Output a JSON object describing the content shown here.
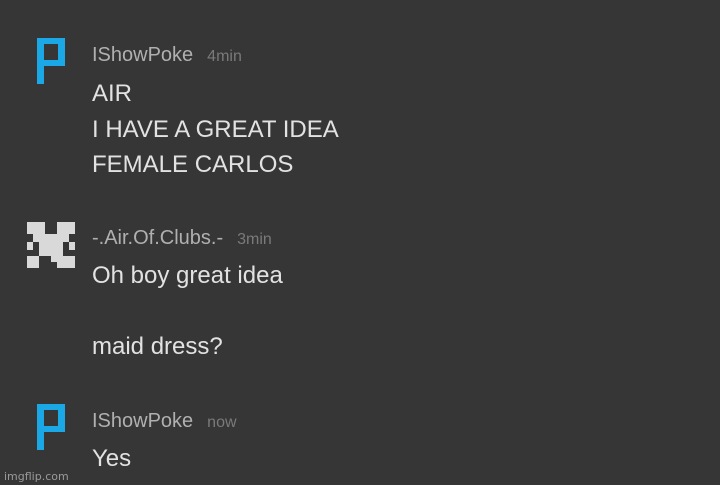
{
  "messages": [
    {
      "username": "IShowPoke",
      "time": "4min",
      "avatar": "pixel-p-icon",
      "lines": [
        "AIR",
        "I HAVE A GREAT IDEA",
        "FEMALE CARLOS"
      ]
    },
    {
      "username": "-.Air.Of.Clubs.-",
      "time": "3min",
      "avatar": "pixel-x-icon",
      "lines": [
        "Oh boy great idea",
        "",
        "maid dress?"
      ]
    },
    {
      "username": "IShowPoke",
      "time": "now",
      "avatar": "pixel-p-icon",
      "lines": [
        "Yes"
      ]
    }
  ],
  "colors": {
    "background": "#363636",
    "username": "#b0b0b0",
    "timestamp": "#7a7a7a",
    "text": "#e2e2e2",
    "avatar_p": "#1aa9e6",
    "avatar_x": "#d9d9d9"
  },
  "watermark": "imgflip.com"
}
